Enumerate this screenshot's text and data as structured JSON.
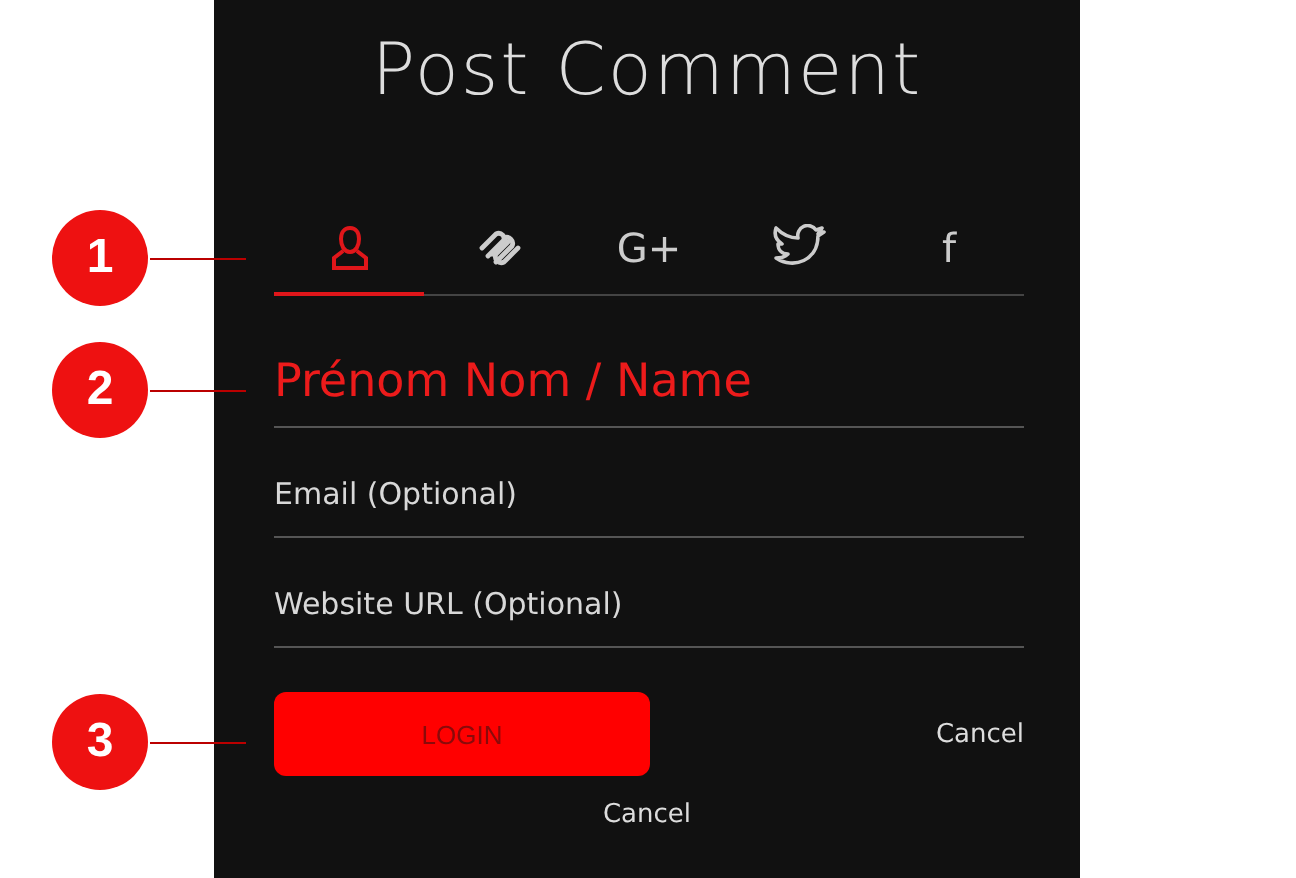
{
  "title": "Post Comment",
  "tabs": [
    {
      "kind": "person",
      "selected": true
    },
    {
      "kind": "squarespace",
      "selected": false
    },
    {
      "kind": "text",
      "label": "G+",
      "selected": false
    },
    {
      "kind": "twitter",
      "selected": false
    },
    {
      "kind": "text",
      "label": "f",
      "selected": false
    }
  ],
  "fields": [
    {
      "placeholder": "Prénom Nom / Name",
      "highlighted": true
    },
    {
      "placeholder": "Email (Optional)",
      "highlighted": false
    },
    {
      "placeholder": "Website URL (Optional)",
      "highlighted": false
    }
  ],
  "login_button": "LOGIN",
  "side_cancel": "Cancel",
  "bottom_cancel": "Cancel",
  "callouts": [
    {
      "number": "1"
    },
    {
      "number": "2"
    },
    {
      "number": "3"
    }
  ]
}
